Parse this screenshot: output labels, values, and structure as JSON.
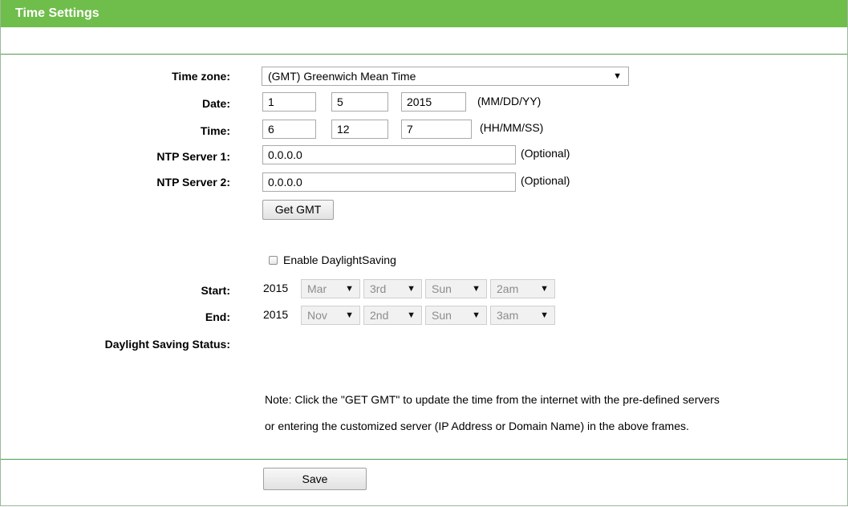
{
  "header": {
    "title": "Time Settings"
  },
  "form": {
    "time_zone": {
      "label": "Time zone:",
      "value": "(GMT) Greenwich Mean Time"
    },
    "date": {
      "label": "Date:",
      "month": "1",
      "day": "5",
      "year": "2015",
      "hint": "(MM/DD/YY)"
    },
    "time": {
      "label": "Time:",
      "hour": "6",
      "minute": "12",
      "second": "7",
      "hint": "(HH/MM/SS)"
    },
    "ntp1": {
      "label": "NTP Server 1:",
      "value": "0.0.0.0",
      "hint": "(Optional)"
    },
    "ntp2": {
      "label": "NTP Server 2:",
      "value": "0.0.0.0",
      "hint": "(Optional)"
    },
    "get_gmt_label": "Get GMT"
  },
  "dst": {
    "enable_label": "Enable DaylightSaving",
    "enabled": false,
    "start": {
      "label": "Start:",
      "year": "2015",
      "month": "Mar",
      "week": "3rd",
      "day": "Sun",
      "hour": "2am"
    },
    "end": {
      "label": "End:",
      "year": "2015",
      "month": "Nov",
      "week": "2nd",
      "day": "Sun",
      "hour": "3am"
    },
    "status_label": "Daylight Saving Status:",
    "status_value": ""
  },
  "note": {
    "line1": "Note: Click the \"GET GMT\" to update the time from the internet with the pre-defined servers",
    "line2": "or entering the customized server (IP Address or Domain Name) in the above frames."
  },
  "footer": {
    "save_label": "Save"
  },
  "colors": {
    "header_bg": "#6fbd4b",
    "rule": "#4f9b4f"
  },
  "icons": {
    "dropdown": "dropdown-arrow-icon",
    "checkbox": "checkbox-icon"
  }
}
